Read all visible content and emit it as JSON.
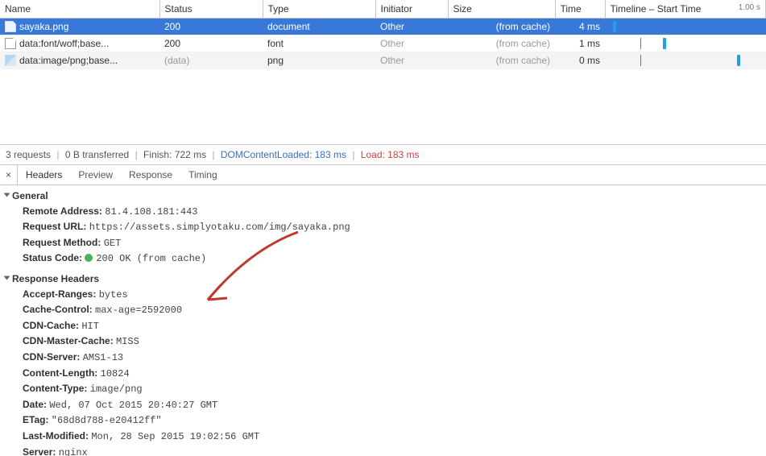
{
  "columns": {
    "name": "Name",
    "status": "Status",
    "type": "Type",
    "initiator": "Initiator",
    "size": "Size",
    "time": "Time",
    "timeline": "Timeline – Start Time",
    "timeline_end": "1.00 s"
  },
  "rows": [
    {
      "name": "sayaka.png",
      "status": "200",
      "type": "document",
      "initiator": "Other",
      "size": "(from cache)",
      "time": "4 ms"
    },
    {
      "name": "data:font/woff;base...",
      "status": "200",
      "type": "font",
      "initiator": "Other",
      "size": "(from cache)",
      "time": "1 ms"
    },
    {
      "name": "data:image/png;base...",
      "status": "(data)",
      "type": "png",
      "initiator": "Other",
      "size": "(from cache)",
      "time": "0 ms"
    }
  ],
  "statusbar": {
    "requests": "3 requests",
    "transferred": "0 B transferred",
    "finish": "Finish: 722 ms",
    "dcl": "DOMContentLoaded: 183 ms",
    "load": "Load: 183 ms"
  },
  "tabs": {
    "headers": "Headers",
    "preview": "Preview",
    "response": "Response",
    "timing": "Timing"
  },
  "general": {
    "title": "General",
    "remote_address_k": "Remote Address:",
    "remote_address_v": "81.4.108.181:443",
    "request_url_k": "Request URL:",
    "request_url_v": "https://assets.simplyotaku.com/img/sayaka.png",
    "request_method_k": "Request Method:",
    "request_method_v": "GET",
    "status_code_k": "Status Code:",
    "status_code_v": "200 OK (from cache)"
  },
  "response_headers": {
    "title": "Response Headers",
    "items": [
      {
        "k": "Accept-Ranges:",
        "v": "bytes"
      },
      {
        "k": "Cache-Control:",
        "v": "max-age=2592000"
      },
      {
        "k": "CDN-Cache:",
        "v": "HIT"
      },
      {
        "k": "CDN-Master-Cache:",
        "v": "MISS"
      },
      {
        "k": "CDN-Server:",
        "v": "AMS1-13"
      },
      {
        "k": "Content-Length:",
        "v": "10824"
      },
      {
        "k": "Content-Type:",
        "v": "image/png"
      },
      {
        "k": "Date:",
        "v": "Wed, 07 Oct 2015 20:40:27 GMT"
      },
      {
        "k": "ETag:",
        "v": "\"68d8d788-e20412ff\""
      },
      {
        "k": "Last-Modified:",
        "v": "Mon, 28 Sep 2015 19:02:56 GMT"
      },
      {
        "k": "Server:",
        "v": "nginx"
      }
    ]
  }
}
